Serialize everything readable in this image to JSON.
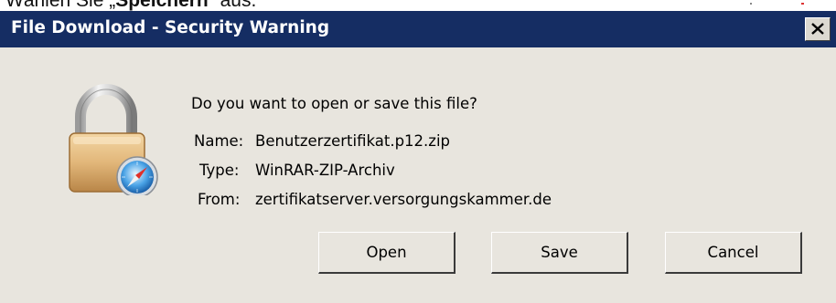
{
  "background": {
    "partial_text_normal": "Wählen Sie „",
    "partial_text_bold": "Speichern",
    "partial_text_end": "“ aus."
  },
  "dialog": {
    "title": "File Download - Security Warning",
    "question": "Do you want to open or save this file?",
    "fields": {
      "name_label": "Name:",
      "name_value": "Benutzerzertifikat.p12.zip",
      "type_label": "Type:",
      "type_value": "WinRAR-ZIP-Archiv",
      "from_label": "From:",
      "from_value": "zertifikatserver.versorgungskammer.de"
    },
    "buttons": {
      "open": "Open",
      "save": "Save",
      "cancel": "Cancel"
    },
    "icons": {
      "close": "close-icon",
      "file_icon": "padlock-safari-icon"
    },
    "colors": {
      "titlebar": "#152d63",
      "dialog_bg": "#e8e5de"
    }
  }
}
